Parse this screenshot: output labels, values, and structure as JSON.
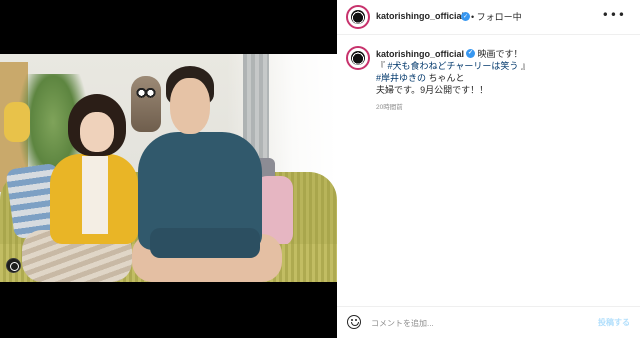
{
  "post": {
    "username": "katorishingo_official",
    "follow_status": "• フォロー中",
    "more_label": "•••",
    "caption": {
      "username": "katorishingo_official",
      "line1": "映画です！",
      "line2_prefix": "『 ",
      "line2_tag": "#犬も食わねどチャーリーは笑う",
      "line2_suffix": " 』",
      "line3_tag": "#岸井ゆきの",
      "line3_suffix": " ちゃんと",
      "line4": "夫婦です。9月公開です！！"
    },
    "timestamp": "20時間前"
  },
  "comment": {
    "placeholder": "コメントを追加...",
    "post_label": "投稿する"
  },
  "icons": {
    "verified": "verified-badge-icon",
    "emoji": "emoji-icon",
    "more": "more-options-icon",
    "multi": "multi-photo-icon"
  },
  "colors": {
    "verified": "#3897f0",
    "hashtag": "#00376b",
    "story_ring": "#c7326c",
    "post_disabled": "#b2dffc"
  }
}
